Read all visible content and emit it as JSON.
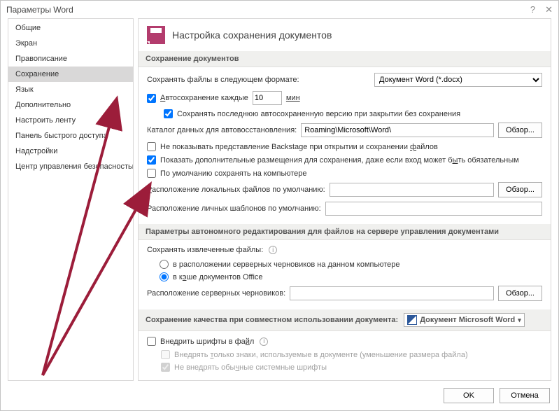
{
  "title": "Параметры Word",
  "sidebar": {
    "items": [
      {
        "label": "Общие"
      },
      {
        "label": "Экран"
      },
      {
        "label": "Правописание"
      },
      {
        "label": "Сохранение"
      },
      {
        "label": "Язык"
      },
      {
        "label": "Дополнительно"
      },
      {
        "label": "Настроить ленту"
      },
      {
        "label": "Панель быстрого доступа"
      },
      {
        "label": "Надстройки"
      },
      {
        "label": "Центр управления безопасностью"
      }
    ],
    "active_index": 3
  },
  "header": {
    "title": "Настройка сохранения документов"
  },
  "section1": {
    "title": "Сохранение документов",
    "format_label": "Сохранять файлы в следующем формате:",
    "format_value": "Документ Word (*.docx)",
    "autosave_label": "Автосохранение каждые",
    "autosave_value": "10",
    "autosave_units": "мин",
    "keep_last_label": "Сохранять последнюю автосохраненную версию при закрытии без сохранения",
    "recover_label": "Каталог данных для автовосстановления:",
    "recover_path": "Roaming\\Microsoft\\Word\\",
    "browse": "Обзор...",
    "no_backstage": "Не показывать представление Backstage при открытии и сохранении файлов",
    "show_extra": "Показать дополнительные размещения для сохранения, даже если вход может быть обязательным",
    "default_pc": "По умолчанию сохранять на компьютере",
    "local_label": "Расположение локальных файлов по умолчанию:",
    "tmpl_label": "Расположение личных шаблонов по умолчанию:"
  },
  "section2": {
    "title": "Параметры автономного редактирования для файлов на сервере управления документами",
    "extract_label": "Сохранять извлеченные файлы:",
    "opt1": "в расположении серверных черновиков на данном компьютере",
    "opt2": "в кэше документов Office",
    "drafts_label": "Расположение серверных черновиков:",
    "browse": "Обзор..."
  },
  "section3": {
    "title": "Сохранение качества при совместном использовании документа:",
    "doc_name": "Документ Microsoft Word",
    "embed": "Внедрить шрифты в файл",
    "embed_only": "Внедрять только знаки, используемые в документе (уменьшение размера файла)",
    "no_embed_sys": "Не внедрять обычные системные шрифты"
  },
  "footer": {
    "ok": "OK",
    "cancel": "Отмена"
  }
}
